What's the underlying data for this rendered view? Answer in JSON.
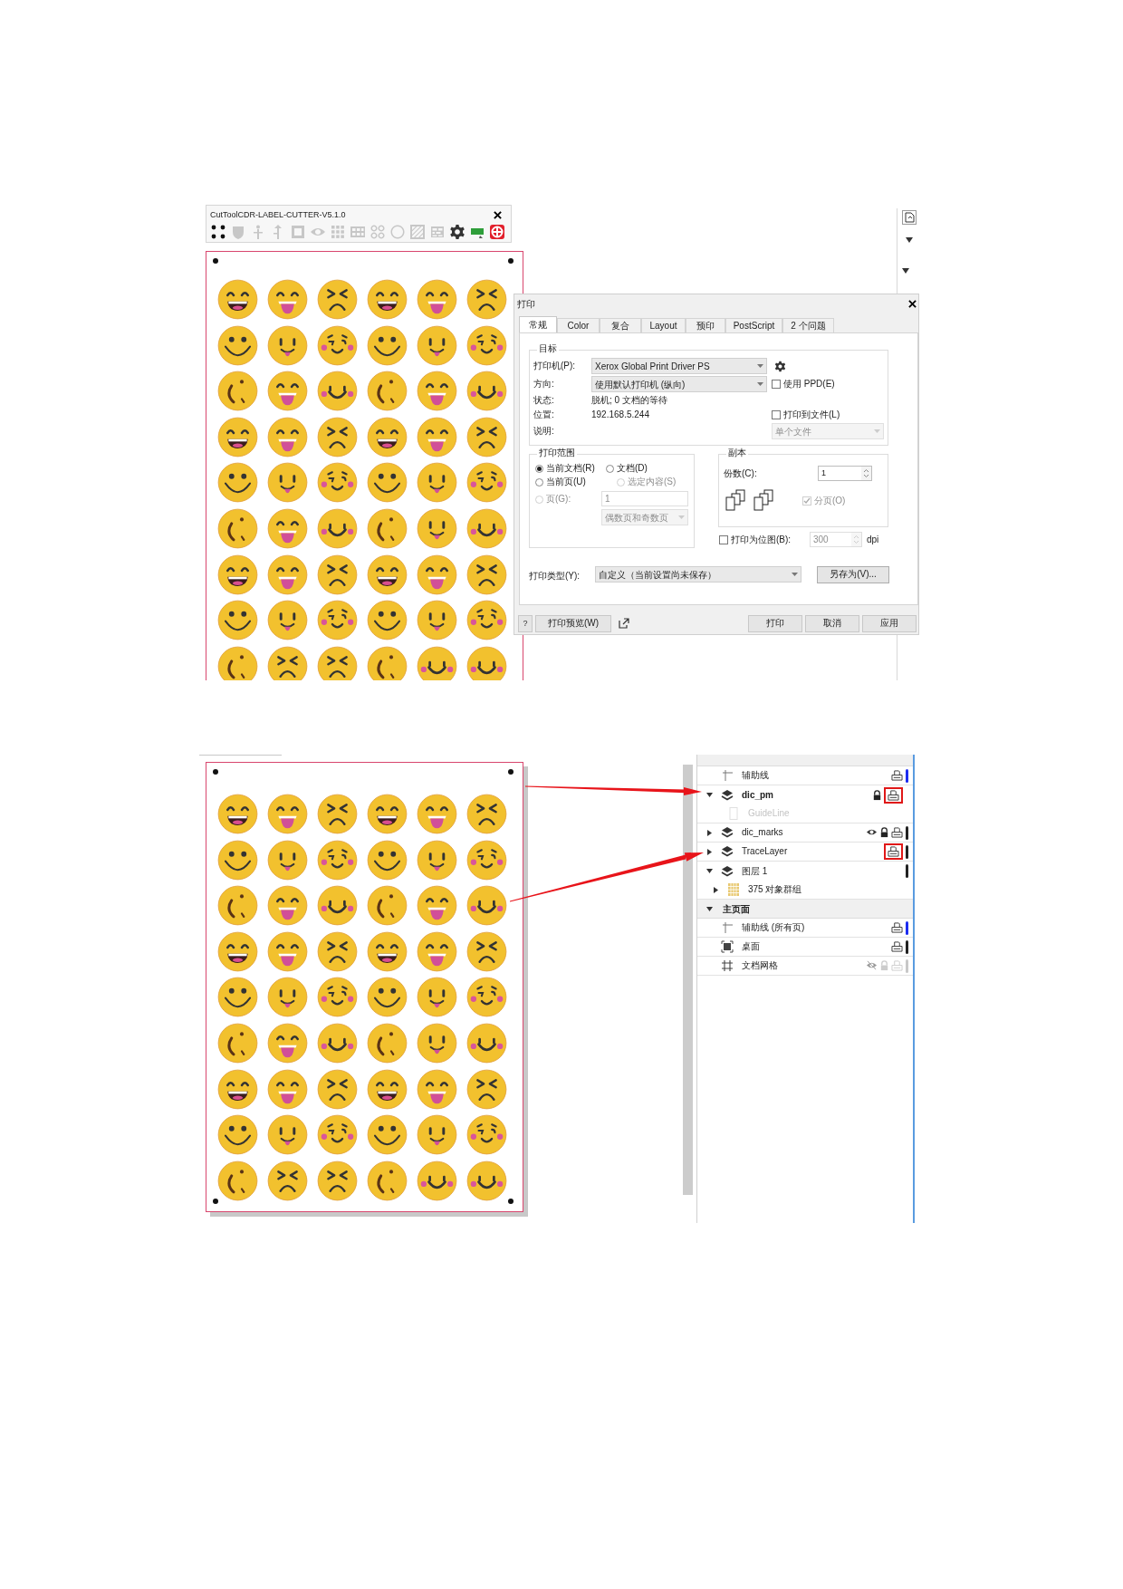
{
  "plugin_toolbar": {
    "title": "CutToolCDR-LABEL-CUTTER-V5.1.0",
    "tools": [
      {
        "disabled": false
      },
      {
        "disabled": true
      },
      {
        "disabled": true
      },
      {
        "disabled": true
      },
      {
        "disabled": true
      },
      {
        "disabled": true
      },
      {
        "disabled": true
      },
      {
        "disabled": true
      },
      {
        "disabled": true
      },
      {
        "disabled": true
      },
      {
        "disabled": true
      },
      {
        "disabled": true
      },
      {
        "disabled": false
      },
      {
        "disabled": false
      },
      {
        "disabled": false
      }
    ]
  },
  "top_sheet": {
    "rows": [
      [
        {
          "kind": "grin"
        },
        {
          "kind": "tongue"
        },
        {
          "kind": "angry"
        },
        {
          "kind": "grin"
        },
        {
          "kind": "tongue"
        },
        {
          "kind": "angry"
        }
      ],
      [
        {
          "kind": "dots"
        },
        {
          "kind": "tongue2"
        },
        {
          "kind": "blushwink"
        },
        {
          "kind": "dots"
        },
        {
          "kind": "tongue2"
        },
        {
          "kind": "blushwink"
        }
      ],
      [
        {
          "kind": "wink"
        },
        {
          "kind": "tongue"
        },
        {
          "kind": "blushsmile"
        },
        {
          "kind": "wink"
        },
        {
          "kind": "tongue"
        },
        {
          "kind": "blushsmile"
        }
      ],
      [
        {
          "kind": "grin"
        },
        {
          "kind": "tongue"
        },
        {
          "kind": "angry"
        },
        {
          "kind": "grin"
        },
        {
          "kind": "tongue"
        },
        {
          "kind": "angry"
        }
      ],
      [
        {
          "kind": "dots"
        },
        {
          "kind": "tongue2"
        },
        {
          "kind": "blushwink"
        },
        {
          "kind": "dots"
        },
        {
          "kind": "tongue2"
        },
        {
          "kind": "blushwink"
        }
      ],
      [
        {
          "kind": "wink"
        },
        {
          "kind": "tongue"
        },
        {
          "kind": "blushsmile"
        },
        {
          "kind": "wink"
        },
        {
          "kind": "tongue2"
        },
        {
          "kind": "blushsmile"
        }
      ],
      [
        {
          "kind": "grin"
        },
        {
          "kind": "tongue"
        },
        {
          "kind": "angry"
        },
        {
          "kind": "grin"
        },
        {
          "kind": "tongue"
        },
        {
          "kind": "angry"
        }
      ],
      [
        {
          "kind": "dots"
        },
        {
          "kind": "tongue2"
        },
        {
          "kind": "blushwink"
        },
        {
          "kind": "dots"
        },
        {
          "kind": "tongue2"
        },
        {
          "kind": "blushwink"
        }
      ],
      [
        {
          "kind": "wink"
        },
        {
          "kind": "angry"
        },
        {
          "kind": "angry"
        },
        {
          "kind": "wink"
        },
        {
          "kind": "blushsmile"
        },
        {
          "kind": "blushsmile"
        }
      ]
    ]
  },
  "print_dialog": {
    "title": "打印",
    "tabs": [
      {
        "label": "常规",
        "selected": true
      },
      {
        "label": "Color",
        "selected": false
      },
      {
        "label": "复合",
        "selected": false
      },
      {
        "label": "Layout",
        "selected": false
      },
      {
        "label": "预印",
        "selected": false
      },
      {
        "label": "PostScript",
        "selected": false
      },
      {
        "label": "2 个问题",
        "selected": false
      }
    ],
    "target": {
      "legend": "目标",
      "printer": {
        "label": "打印机(P):",
        "value": "Xerox Global Print Driver PS"
      },
      "orientation": {
        "label": "方向:",
        "value": "使用默认打印机 (纵向)"
      },
      "use_ppd": {
        "label": "使用 PPD(E)",
        "checked": false
      },
      "status": {
        "label": "状态:",
        "value": "脱机; 0 文档的等待"
      },
      "location": {
        "label": "位置:",
        "value": "192.168.5.244"
      },
      "print_to_file": {
        "label": "打印到文件(L)",
        "checked": false
      },
      "comment": {
        "label": "说明:"
      },
      "file_mode": {
        "value": "单个文件",
        "disabled": true
      }
    },
    "range": {
      "legend": "打印范围",
      "options": [
        {
          "label": "当前文档(R)",
          "selected": true,
          "disabled": false
        },
        {
          "label": "文档(D)",
          "selected": false,
          "disabled": false
        },
        {
          "label": "当前页(U)",
          "selected": false,
          "disabled": false
        },
        {
          "label": "选定内容(S)",
          "selected": false,
          "disabled": true
        },
        {
          "label": "页(G):",
          "selected": false,
          "disabled": true
        }
      ],
      "pages_value": "1",
      "page_set": "偶数页和奇数页"
    },
    "copies": {
      "legend": "副本",
      "label": "份数(C):",
      "value": "1",
      "collate": {
        "label": "分页(O)",
        "checked": true,
        "disabled": true
      }
    },
    "bitmap": {
      "label": "打印为位图(B):",
      "checked": false,
      "dpi_value": "300",
      "unit": "dpi"
    },
    "print_type": {
      "label": "打印类型(Y):",
      "value": "自定义（当前设置尚未保存）"
    },
    "save_as": "另存为(V)...",
    "help": "?",
    "preview": "打印预览(W)",
    "buttons": [
      "打印",
      "取消",
      "应用"
    ]
  },
  "bottom_sheet": {
    "rows": [
      [
        {
          "kind": "grin"
        },
        {
          "kind": "tongue"
        },
        {
          "kind": "angry"
        },
        {
          "kind": "grin"
        },
        {
          "kind": "tongue"
        },
        {
          "kind": "angry"
        }
      ],
      [
        {
          "kind": "dots"
        },
        {
          "kind": "tongue2"
        },
        {
          "kind": "blushwink"
        },
        {
          "kind": "dots"
        },
        {
          "kind": "tongue2"
        },
        {
          "kind": "blushwink"
        }
      ],
      [
        {
          "kind": "wink"
        },
        {
          "kind": "tongue"
        },
        {
          "kind": "blushsmile"
        },
        {
          "kind": "wink"
        },
        {
          "kind": "tongue"
        },
        {
          "kind": "blushsmile"
        }
      ],
      [
        {
          "kind": "grin"
        },
        {
          "kind": "tongue"
        },
        {
          "kind": "angry"
        },
        {
          "kind": "grin"
        },
        {
          "kind": "tongue"
        },
        {
          "kind": "angry"
        }
      ],
      [
        {
          "kind": "dots"
        },
        {
          "kind": "tongue2"
        },
        {
          "kind": "blushwink"
        },
        {
          "kind": "dots"
        },
        {
          "kind": "tongue2"
        },
        {
          "kind": "blushwink"
        }
      ],
      [
        {
          "kind": "wink"
        },
        {
          "kind": "tongue"
        },
        {
          "kind": "blushsmile"
        },
        {
          "kind": "wink"
        },
        {
          "kind": "tongue2"
        },
        {
          "kind": "blushsmile"
        }
      ],
      [
        {
          "kind": "grin"
        },
        {
          "kind": "tongue"
        },
        {
          "kind": "angry"
        },
        {
          "kind": "grin"
        },
        {
          "kind": "tongue"
        },
        {
          "kind": "angry"
        }
      ],
      [
        {
          "kind": "dots"
        },
        {
          "kind": "tongue2"
        },
        {
          "kind": "blushwink"
        },
        {
          "kind": "dots"
        },
        {
          "kind": "tongue2"
        },
        {
          "kind": "blushwink"
        }
      ],
      [
        {
          "kind": "wink"
        },
        {
          "kind": "angry"
        },
        {
          "kind": "angry"
        },
        {
          "kind": "wink"
        },
        {
          "kind": "blushsmile"
        },
        {
          "kind": "blushsmile"
        }
      ]
    ]
  },
  "layers_panel": {
    "page_layers": [
      {
        "kind": "guides",
        "label": "辅助线",
        "bold": false,
        "disabled": false,
        "controls": [
          {
            "kind": "printer",
            "highlighted": false
          }
        ],
        "color": "#1c2cf0"
      },
      {
        "kind": "layer",
        "label": "dic_pm",
        "bold": true,
        "disabled": false,
        "expanded": true,
        "controls": [
          {
            "kind": "lock",
            "highlighted": false
          },
          {
            "kind": "printer",
            "highlighted": true
          }
        ],
        "children": [
          {
            "kind": "page",
            "label": "GuideLine",
            "bold": false,
            "disabled": true
          }
        ]
      },
      {
        "kind": "layer",
        "label": "dic_marks",
        "bold": false,
        "disabled": false,
        "expanded": false,
        "controls": [
          {
            "kind": "eye",
            "highlighted": false
          },
          {
            "kind": "lock",
            "highlighted": false
          },
          {
            "kind": "printer",
            "highlighted": false
          }
        ],
        "color": "#222222"
      },
      {
        "kind": "layer",
        "label": "TraceLayer",
        "bold": false,
        "disabled": false,
        "expanded": false,
        "controls": [
          {
            "kind": "printer",
            "highlighted": true
          }
        ],
        "color": "#222222"
      },
      {
        "kind": "layer",
        "label": "图层 1",
        "bold": false,
        "disabled": false,
        "expanded": true,
        "color": "#222222",
        "children": [
          {
            "kind": "group",
            "label": "375 对象群组",
            "bold": false,
            "disabled": false,
            "expanded": false
          }
        ]
      }
    ],
    "master_page": {
      "title": "主页面",
      "expanded": true,
      "layers": [
        {
          "kind": "guides",
          "label": "辅助线 (所有页)",
          "bold": false,
          "disabled": false,
          "controls": [
            {
              "kind": "printer",
              "highlighted": false
            }
          ],
          "color": "#1c2cf0"
        },
        {
          "kind": "desktop",
          "label": "桌面",
          "bold": false,
          "disabled": false,
          "controls": [
            {
              "kind": "printer",
              "highlighted": false
            }
          ],
          "color": "#222222"
        },
        {
          "kind": "grid",
          "label": "文档网格",
          "bold": false,
          "disabled": false,
          "controls": [
            {
              "kind": "eye-off",
              "highlighted": false
            },
            {
              "kind": "lock-off",
              "highlighted": false
            },
            {
              "kind": "printer-off",
              "highlighted": false
            }
          ],
          "color": "#c8c8c8"
        }
      ]
    }
  }
}
